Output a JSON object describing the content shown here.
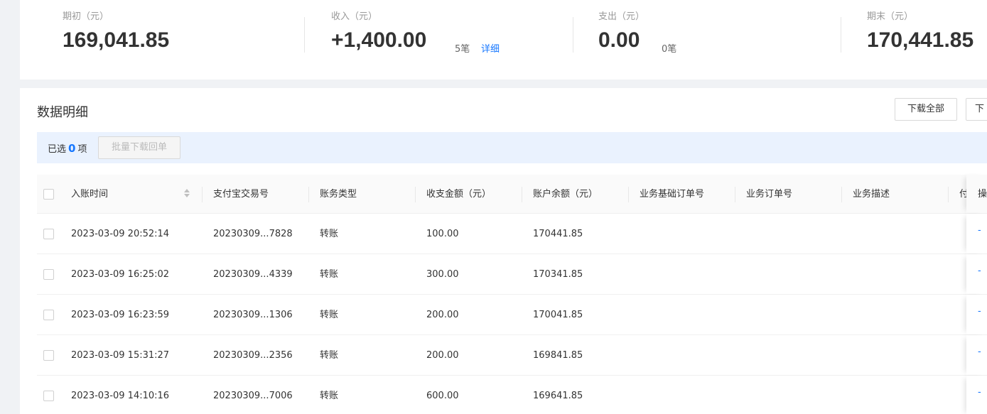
{
  "summary": {
    "opening": {
      "label": "期初（元）",
      "value": "169,041.85"
    },
    "income": {
      "label": "收入（元）",
      "value": "+1,400.00",
      "count": "5笔",
      "link": "详细"
    },
    "expense": {
      "label": "支出（元）",
      "value": "0.00",
      "count": "0笔"
    },
    "closing": {
      "label": "期末（元）",
      "value": "170,441.85"
    }
  },
  "data": {
    "title": "数据明细",
    "download_all": "下载全部",
    "download_more": "下",
    "selection": {
      "prefix": "已选",
      "count": "0",
      "suffix": "项",
      "batch_button": "批量下载回单"
    }
  },
  "table": {
    "headers": [
      "入账时间",
      "支付宝交易号",
      "账务类型",
      "收支金额（元）",
      "账户余额（元）",
      "业务基础订单号",
      "业务订单号",
      "业务描述",
      "付"
    ],
    "action_header": "操",
    "rows": [
      {
        "time": "2023-03-09 20:52:14",
        "trade_no": "20230309...7828",
        "type": "转账",
        "amount": "100.00",
        "balance": "170441.85",
        "action": "-"
      },
      {
        "time": "2023-03-09 16:25:02",
        "trade_no": "20230309...4339",
        "type": "转账",
        "amount": "300.00",
        "balance": "170341.85",
        "action": "-"
      },
      {
        "time": "2023-03-09 16:23:59",
        "trade_no": "20230309...1306",
        "type": "转账",
        "amount": "200.00",
        "balance": "170041.85",
        "action": "-"
      },
      {
        "time": "2023-03-09 15:31:27",
        "trade_no": "20230309...2356",
        "type": "转账",
        "amount": "200.00",
        "balance": "169841.85",
        "action": "-"
      },
      {
        "time": "2023-03-09 14:10:16",
        "trade_no": "20230309...7006",
        "type": "转账",
        "amount": "600.00",
        "balance": "169641.85",
        "action": "-"
      }
    ]
  }
}
